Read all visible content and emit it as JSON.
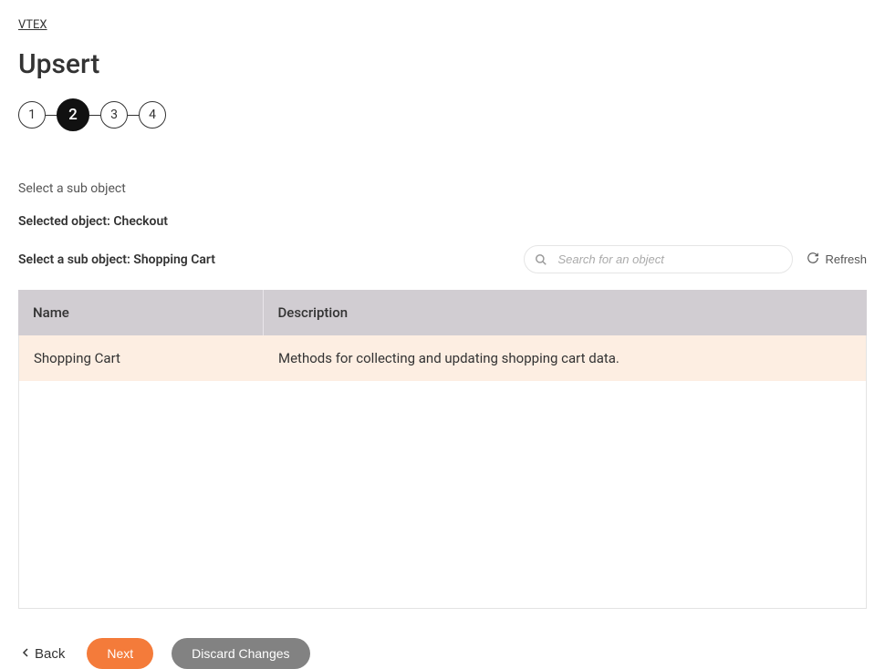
{
  "breadcrumb": "VTEX",
  "page_title": "Upsert",
  "stepper": {
    "steps": [
      "1",
      "2",
      "3",
      "4"
    ],
    "active_index": 1
  },
  "subtitle": "Select a sub object",
  "selected_object_label": "Selected object: Checkout",
  "select_sub_label": "Select a sub object: Shopping Cart",
  "search": {
    "placeholder": "Search for an object"
  },
  "refresh_label": "Refresh",
  "table": {
    "headers": {
      "name": "Name",
      "description": "Description"
    },
    "rows": [
      {
        "name": "Shopping Cart",
        "description": "Methods for collecting and updating shopping cart data.",
        "selected": true
      }
    ]
  },
  "footer": {
    "back": "Back",
    "next": "Next",
    "discard": "Discard Changes"
  }
}
